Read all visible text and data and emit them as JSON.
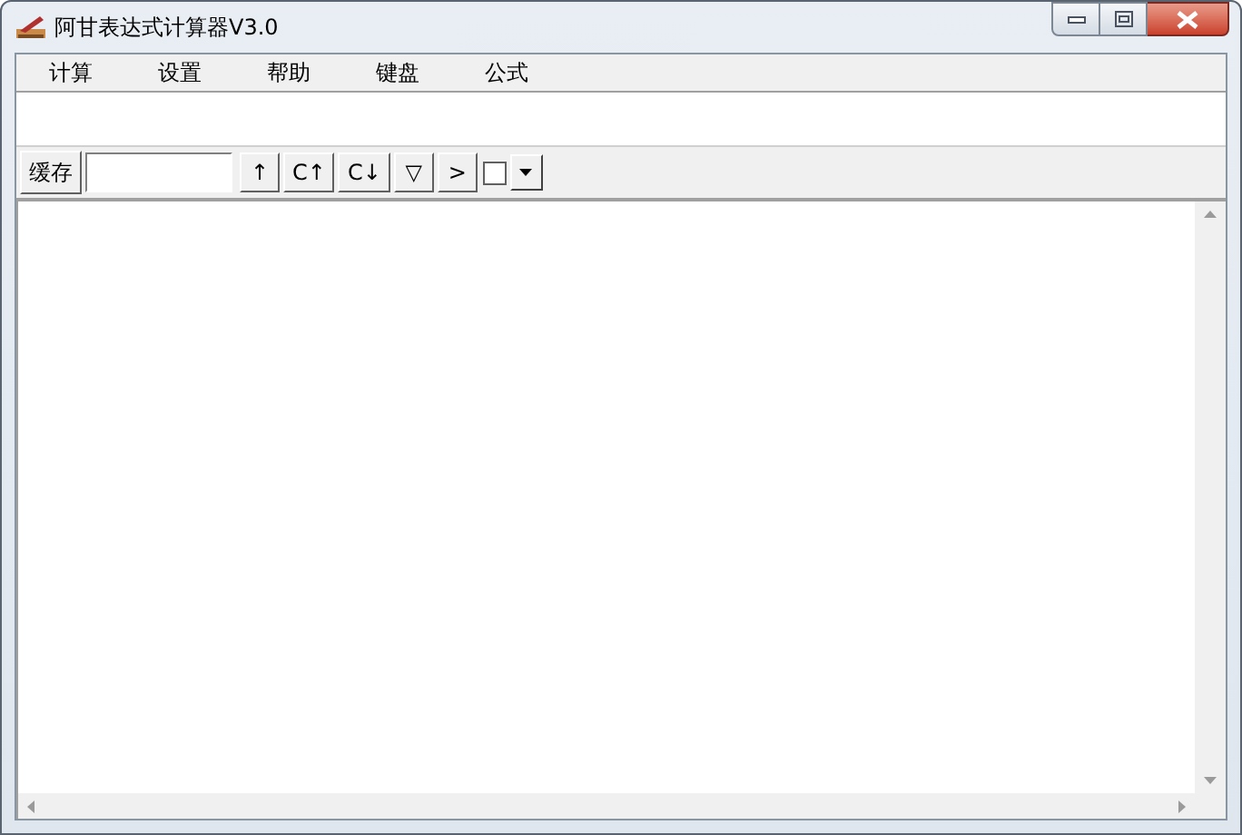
{
  "window": {
    "title": "阿甘表达式计算器V3.0"
  },
  "menu": [
    "计算",
    "设置",
    "帮助",
    "键盘",
    "公式"
  ],
  "toolbar": {
    "cache_button": "缓存",
    "buttons": [
      {
        "label": "↑"
      },
      {
        "label": "C↑"
      },
      {
        "label": "C↓"
      },
      {
        "label": "▽"
      },
      {
        "label": ">"
      }
    ],
    "checkbox": {
      "checked": false
    }
  }
}
